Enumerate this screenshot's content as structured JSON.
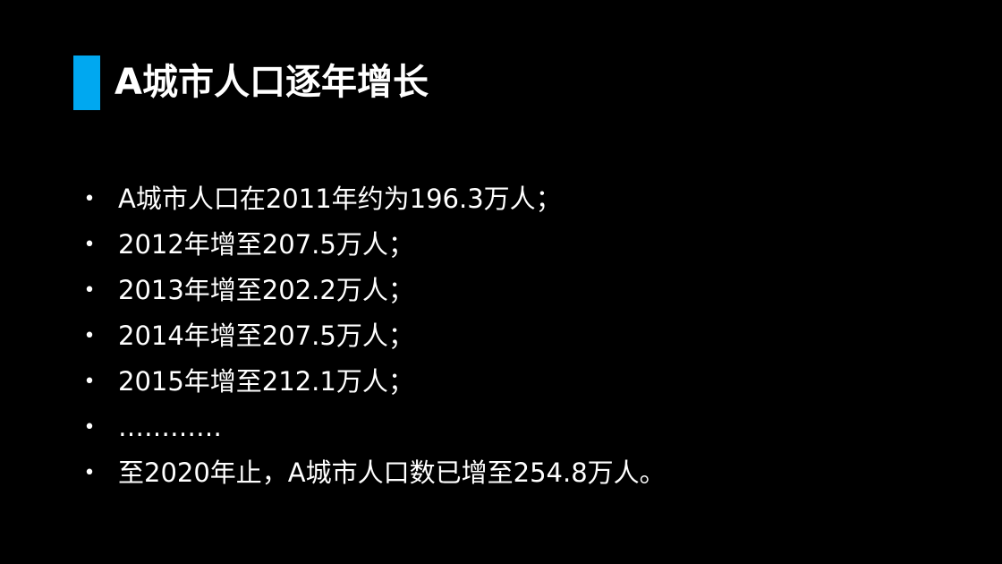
{
  "slide": {
    "title": "A城市人口逐年增长",
    "accent_color": "#00a8f0",
    "bullet_symbol": "•",
    "bullets": [
      "A城市人口在2011年约为196.3万人；",
      "2012年增至207.5万人；",
      "2013年增至202.2万人；",
      "2014年增至207.5万人；",
      "2015年增至212.1万人；",
      "…………",
      "至2020年止，A城市人口数已增至254.8万人。"
    ]
  }
}
